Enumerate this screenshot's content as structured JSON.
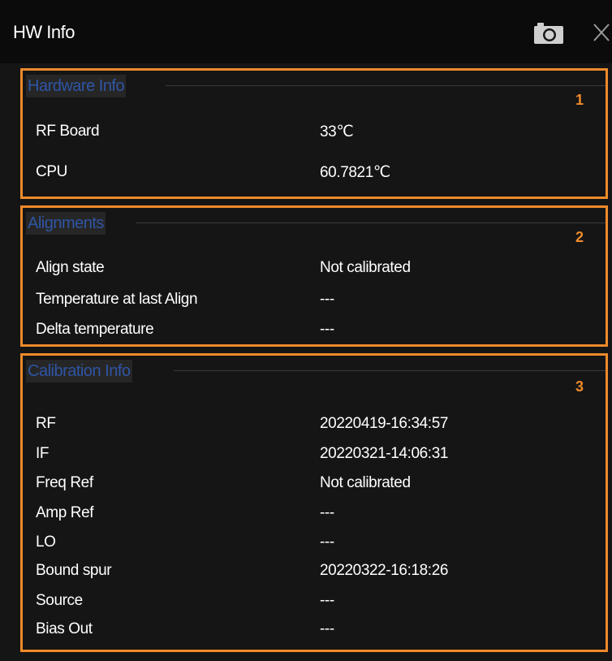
{
  "window": {
    "title": "HW Info",
    "icons": {
      "screenshot": "camera-icon",
      "close": "close-icon"
    }
  },
  "colors": {
    "border": "#ee8a2a",
    "section_title": "#2f55a5",
    "background": "#151515"
  },
  "sections": {
    "hardware": {
      "title": "Hardware Info",
      "number": "1",
      "rows": [
        {
          "label": "RF Board",
          "value": "33℃"
        },
        {
          "label": "CPU",
          "value": "60.7821℃"
        }
      ]
    },
    "alignments": {
      "title": "Alignments",
      "number": "2",
      "rows": [
        {
          "label": "Align state",
          "value": "Not calibrated"
        },
        {
          "label": "Temperature at last Align",
          "value": "---"
        },
        {
          "label": "Delta temperature",
          "value": "---"
        }
      ]
    },
    "calibration": {
      "title": "Calibration Info",
      "number": "3",
      "rows": [
        {
          "label": "RF",
          "value": "20220419-16:34:57"
        },
        {
          "label": "IF",
          "value": "20220321-14:06:31"
        },
        {
          "label": "Freq Ref",
          "value": "Not calibrated"
        },
        {
          "label": "Amp Ref",
          "value": "---"
        },
        {
          "label": "LO",
          "value": "---"
        },
        {
          "label": "Bound spur",
          "value": "20220322-16:18:26"
        },
        {
          "label": "Source",
          "value": "---"
        },
        {
          "label": "Bias Out",
          "value": "---"
        }
      ]
    }
  }
}
